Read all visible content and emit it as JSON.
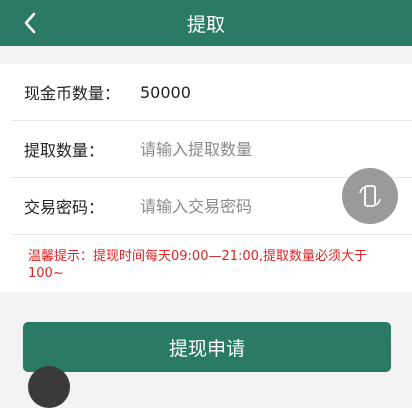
{
  "header": {
    "title": "提取",
    "back_icon": "chevron-left-icon"
  },
  "form": {
    "cash_coin": {
      "label": "现金币数量：",
      "value": "50000"
    },
    "withdraw_amount": {
      "label": "提取数量：",
      "placeholder": "请输入提取数量",
      "value": ""
    },
    "trade_password": {
      "label": "交易密码：",
      "placeholder": "请输入交易密码",
      "value": ""
    }
  },
  "tip": "温馨提示：提现时间每天09:00—21:00,提取数量必须大于100~",
  "submit_label": "提现申请",
  "floating_button_icon": "phone-rotate-icon",
  "colors": {
    "primary": "#2a7a66",
    "tip_text": "#e02424",
    "background": "#f2f2f2"
  }
}
